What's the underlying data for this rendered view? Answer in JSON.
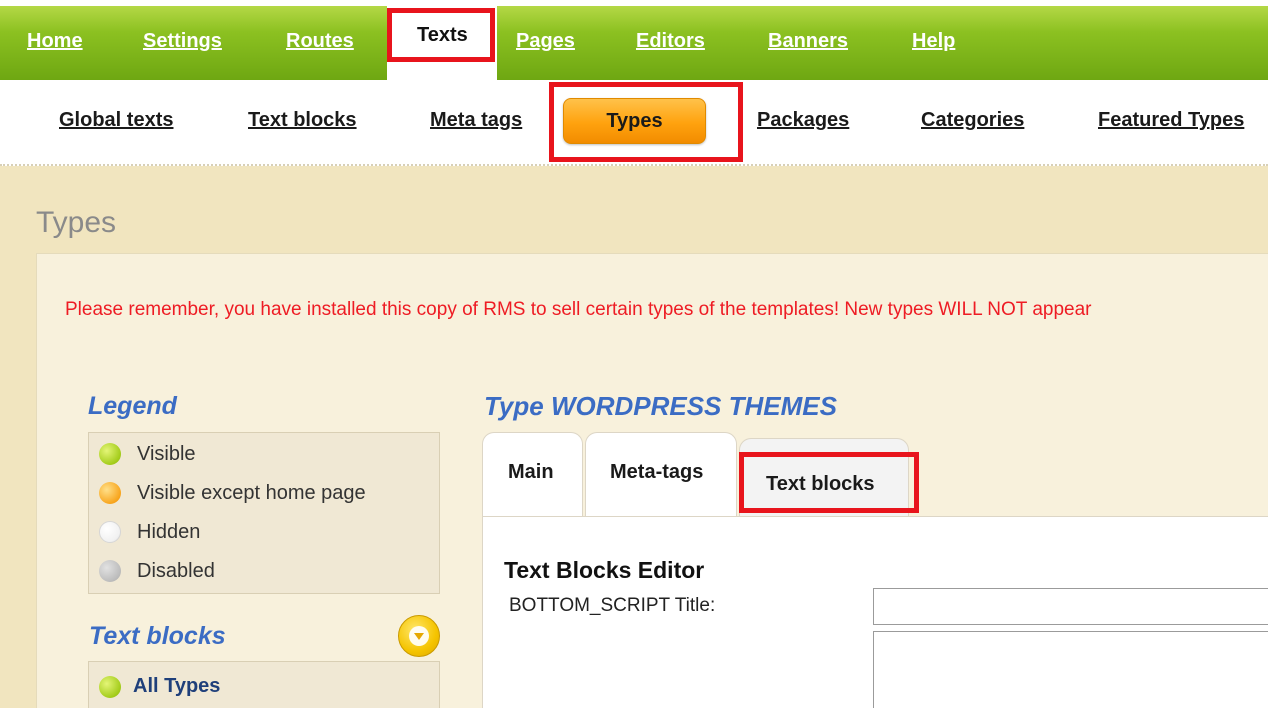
{
  "top_nav": {
    "items": [
      "Home",
      "Settings",
      "Routes",
      "Texts",
      "Pages",
      "Editors",
      "Banners",
      "Help"
    ],
    "active": "Texts"
  },
  "sub_nav": {
    "items": [
      "Global texts",
      "Text blocks",
      "Meta tags",
      "Types",
      "Packages",
      "Categories",
      "Featured Types"
    ],
    "active": "Types"
  },
  "page": {
    "title": "Types",
    "notice": "Please remember, you have installed this copy of RMS to sell certain types of the templates! New types WILL NOT appear"
  },
  "legend": {
    "heading": "Legend",
    "items": [
      {
        "label": "Visible",
        "icon": "green-dot-icon"
      },
      {
        "label": "Visible except home page",
        "icon": "orange-dot-icon"
      },
      {
        "label": "Hidden",
        "icon": "white-dot-icon"
      },
      {
        "label": "Disabled",
        "icon": "gray-dot-icon"
      }
    ]
  },
  "text_blocks_sidebar": {
    "heading": "Text blocks",
    "toggle_icon": "chevron-down-icon",
    "items": [
      {
        "label": "All Types",
        "icon": "green-dot-icon"
      }
    ]
  },
  "editor": {
    "type_heading": "Type WORDPRESS THEMES",
    "tabs": [
      "Main",
      "Meta-tags",
      "Text blocks"
    ],
    "active_tab": "Text blocks",
    "title": "Text Blocks Editor",
    "field_label": "BOTTOM_SCRIPT Title:",
    "title_value": "",
    "body_value": ""
  },
  "colors": {
    "nav_green": "#8cc121",
    "accent_orange": "#ffa20e",
    "highlight_red": "#e8141c",
    "heading_blue": "#3b6cc4",
    "notice_red": "#ee1c24",
    "background": "#f1e5bf"
  }
}
